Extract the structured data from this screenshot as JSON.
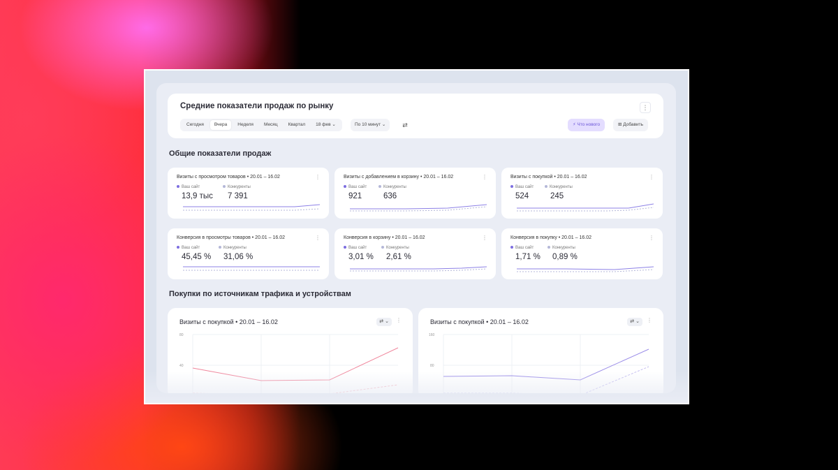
{
  "header": {
    "title": "Средние показатели продаж по рынку",
    "menu_glyph": "⋮",
    "period_tabs": [
      "Сегодня",
      "Вчера",
      "Неделя",
      "Месяц",
      "Квартал"
    ],
    "active_tab": "Вчера",
    "date_select": "18 фев",
    "interval_select": "По 10 минут",
    "whats_new_label": "Что нового",
    "add_label": "Добавить"
  },
  "sections": {
    "kpi_title": "Общие показатели продаж",
    "traffic_title": "Покупки по источникам трафика и устройствам"
  },
  "legend": {
    "own": "Ваш сайт",
    "competitors": "Конкуренты",
    "own_color": "#7d6ee0",
    "competitors_color": "#b4b7d8"
  },
  "kpis": [
    {
      "title": "Визиты с просмотром товаров • 20.01 – 16.02",
      "own": "13,9 тыс",
      "competitors": "7 391"
    },
    {
      "title": "Визиты с добавлением в корзину • 20.01 – 16.02",
      "own": "921",
      "competitors": "636"
    },
    {
      "title": "Визиты с покупкой • 20.01 – 16.02",
      "own": "524",
      "competitors": "245"
    },
    {
      "title": "Конверсия в просмотры товаров • 20.01 – 16.02",
      "own": "45,45 %",
      "competitors": "31,06 %"
    },
    {
      "title": "Конверсия в корзину • 20.01 – 16.02",
      "own": "3,01 %",
      "competitors": "2,61 %"
    },
    {
      "title": "Конверсия в покупку • 20.01 – 16.02",
      "own": "1,71 %",
      "competitors": "0,89 %"
    }
  ],
  "charts": [
    {
      "title": "Визиты с покупкой • 20.01 – 16.02",
      "y_ticks": [
        "80",
        "40"
      ],
      "line_color": "#f0869c",
      "y_max": 80
    },
    {
      "title": "Визиты с покупкой • 20.01 – 16.02",
      "y_ticks": [
        "160",
        "80"
      ],
      "line_color": "#9a8ce8",
      "y_max": 160
    }
  ]
}
